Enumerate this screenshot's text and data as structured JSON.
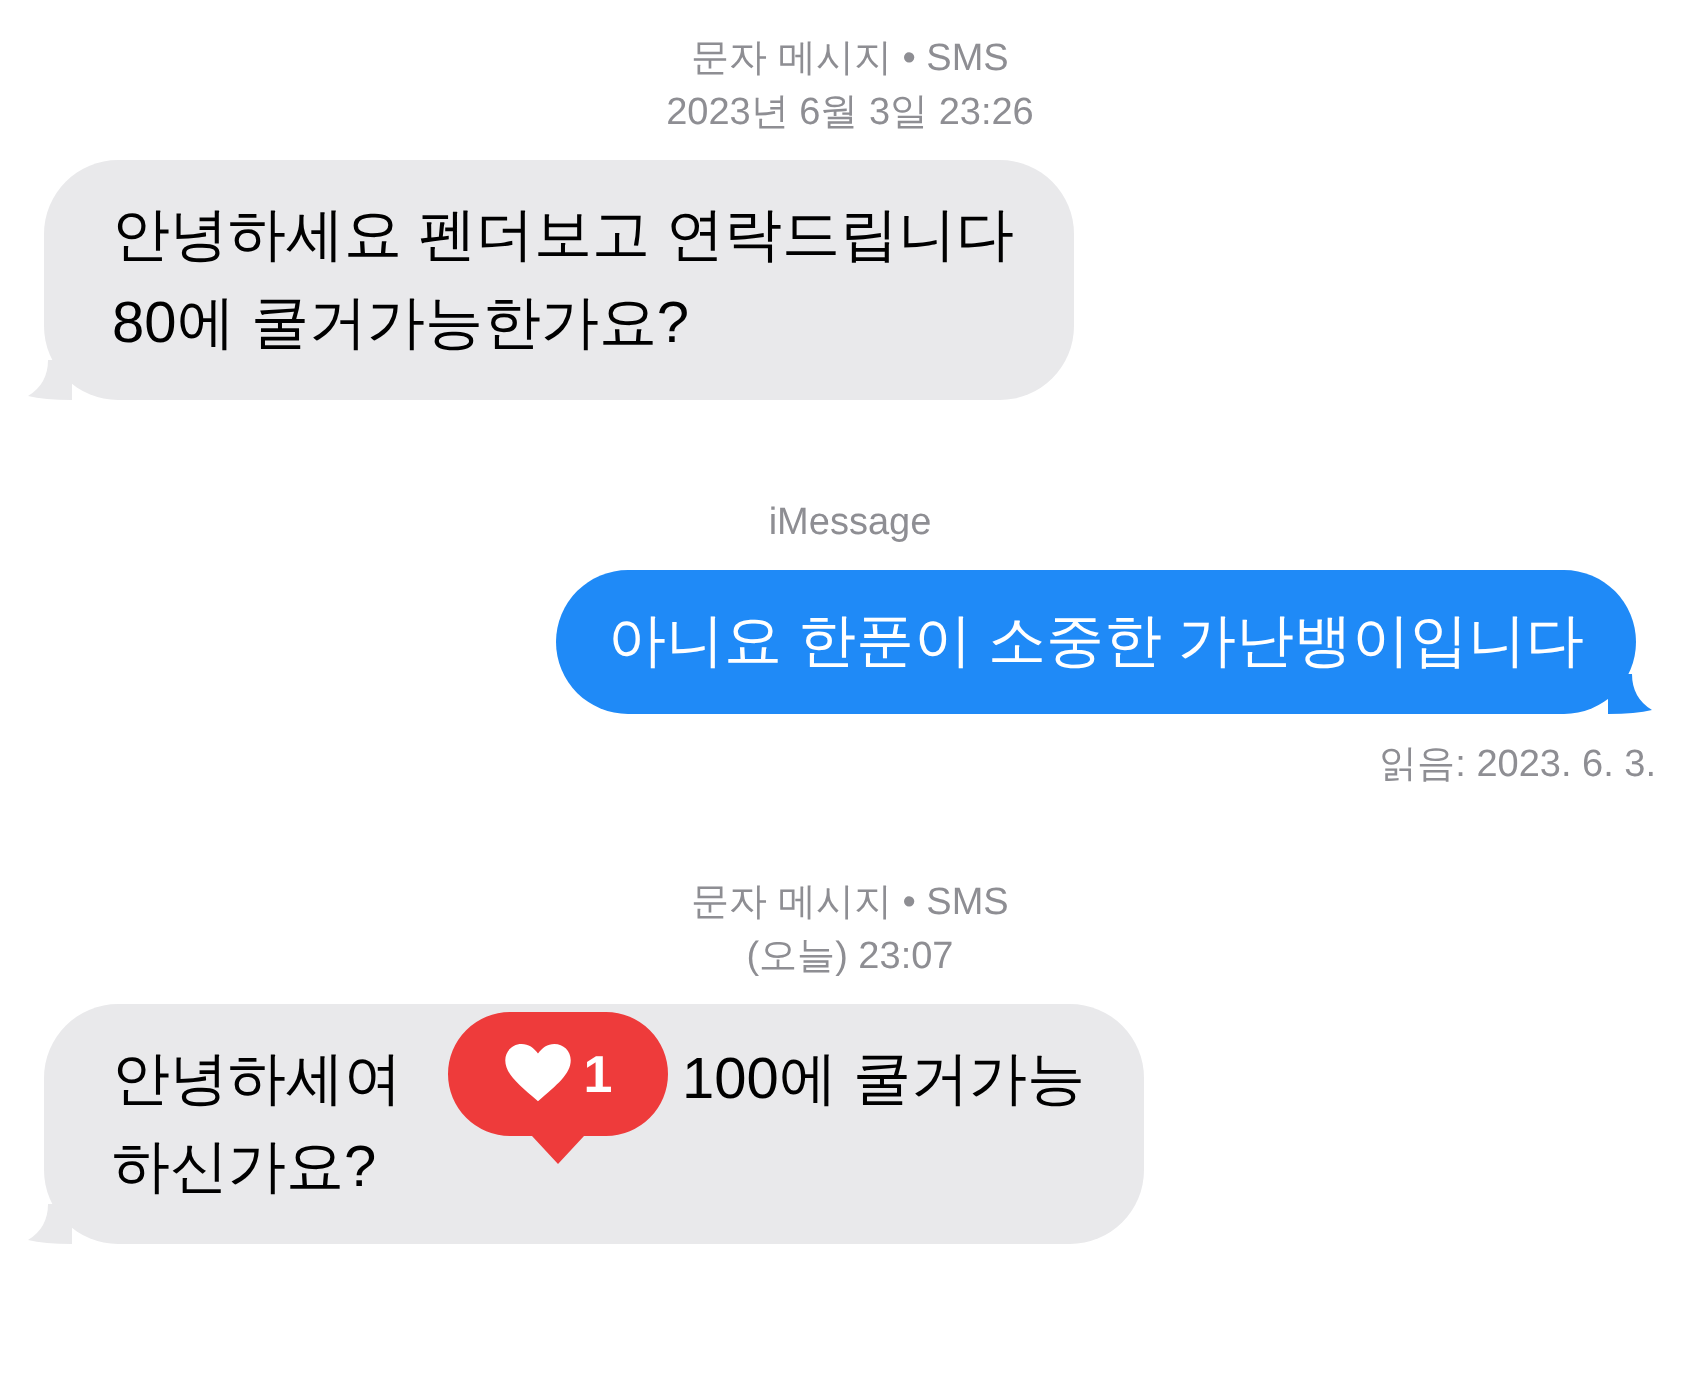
{
  "thread": [
    {
      "kind": "timestamp",
      "lines": [
        "문자 메시지 • SMS",
        "2023년 6월 3일 23:26"
      ]
    },
    {
      "kind": "received",
      "parts": [
        [
          "안녕하세요 펜더보고 연락드립니다\n80에 쿨거가능한가요?"
        ]
      ]
    },
    {
      "kind": "service",
      "text": "iMessage"
    },
    {
      "kind": "sent",
      "parts": [
        [
          "아니요 한푼이 소중한 가난뱅이입니다"
        ]
      ],
      "receipt": "읽음: 2023. 6. 3."
    },
    {
      "kind": "timestamp",
      "lines": [
        "문자 메시지 • SMS",
        "(오늘) 23:07"
      ]
    },
    {
      "kind": "received",
      "parts": [
        [
          "안녕하세여",
          "100에 쿨거가능"
        ],
        [
          "하신가요?"
        ]
      ],
      "reaction": {
        "count": "1"
      }
    }
  ]
}
